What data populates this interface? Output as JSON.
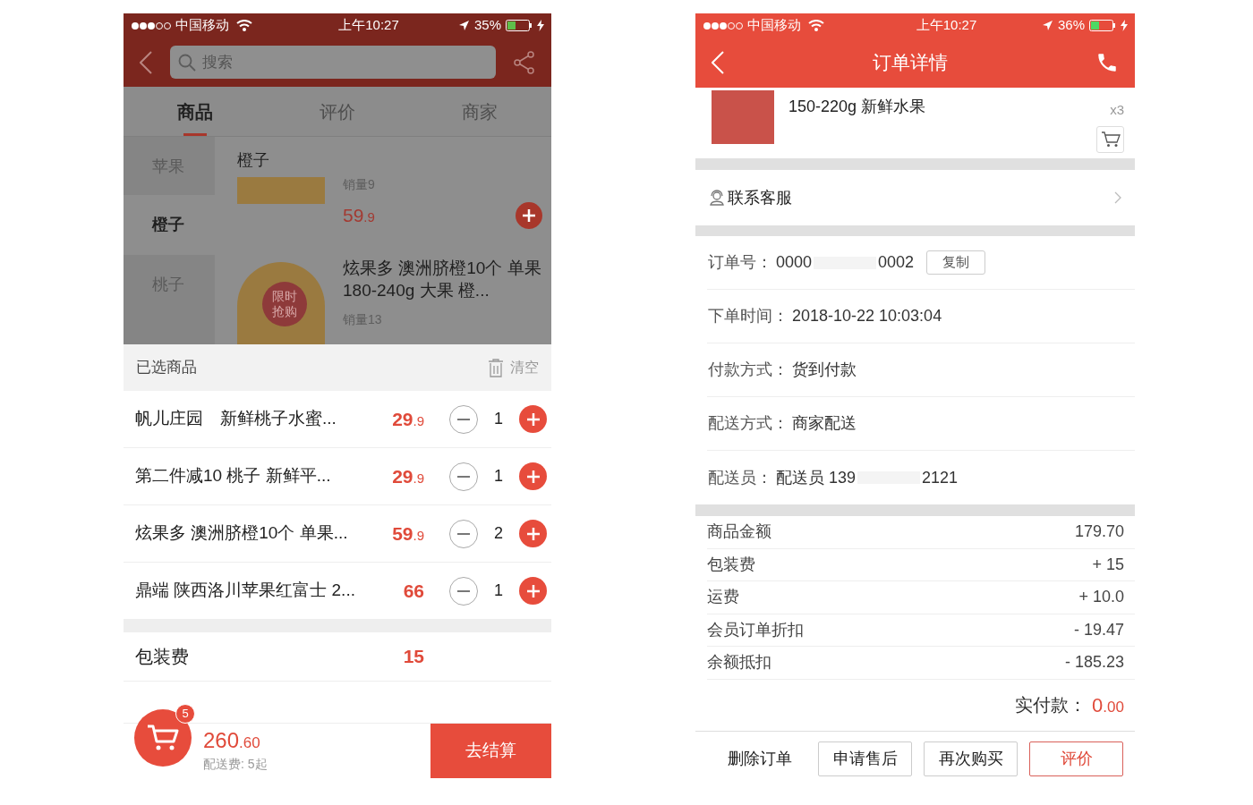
{
  "left_screen": {
    "status_bar": {
      "carrier": "中国移动",
      "time": "上午10:27",
      "battery": "35%"
    },
    "search": {
      "placeholder": "搜索"
    },
    "tabs": [
      {
        "label": "商品",
        "selected": true
      },
      {
        "label": "评价",
        "selected": false
      },
      {
        "label": "商家",
        "selected": false
      }
    ],
    "categories": [
      {
        "label": "苹果",
        "selected": false
      },
      {
        "label": "橙子",
        "selected": true
      },
      {
        "label": "桃子",
        "selected": false
      }
    ],
    "section_title": "橙子",
    "products": [
      {
        "sales": "销量9",
        "price_main": "59",
        "price_decimal": ".9"
      },
      {
        "badge": "限时抢购",
        "name": "炫果多 澳洲脐橙10个 单果180-240g 大果 橙...",
        "sales": "销量13"
      }
    ],
    "cart": {
      "title": "已选商品",
      "clear": "清空",
      "items": [
        {
          "name": "帆儿庄园　新鲜桃子水蜜...",
          "price_main": "29",
          "price_decimal": ".9",
          "qty": "1"
        },
        {
          "name": "第二件减10  桃子 新鲜平...",
          "price_main": "29",
          "price_decimal": ".9",
          "qty": "1"
        },
        {
          "name": "炫果多 澳洲脐橙10个 单果...",
          "price_main": "59",
          "price_decimal": ".9",
          "qty": "2"
        },
        {
          "name": "鼎端 陕西洛川苹果红富士 2...",
          "price_main": "66",
          "qty": "1"
        }
      ],
      "packaging": {
        "label": "包装费",
        "amount": "15"
      },
      "count": "5",
      "total_main": "260",
      "total_decimal": ".60",
      "delivery_note": "配送费: 5起",
      "checkout": "去结算"
    }
  },
  "right_screen": {
    "status_bar": {
      "carrier": "中国移动",
      "time": "上午10:27",
      "battery": "36%"
    },
    "title": "订单详情",
    "order_item": {
      "name": "150-220g 新鲜水果",
      "quantity": "x3"
    },
    "contact": "联系客服",
    "info_rows": [
      {
        "label": "订单号：",
        "value": "0000",
        "value_tail": "0002",
        "action": "复制"
      },
      {
        "label": "下单时间：",
        "value": "2018-10-22 10:03:04"
      },
      {
        "label": "付款方式：",
        "value": "货到付款"
      },
      {
        "label": "配送方式：",
        "value": "商家配送"
      },
      {
        "label": "配送员：",
        "value": "配送员 139",
        "value_tail": "2121"
      }
    ],
    "fees": [
      {
        "label": "商品金额",
        "amount": "179.70"
      },
      {
        "label": "包装费",
        "amount": "+ 15"
      },
      {
        "label": "运费",
        "amount": "+ 10.0"
      },
      {
        "label": "会员订单折扣",
        "amount": "- 19.47"
      },
      {
        "label": "余额抵扣",
        "amount": "- 185.23"
      }
    ],
    "paid": {
      "label": "实付款：",
      "main": "0",
      "decimal": ".00"
    },
    "actions": [
      {
        "label": "删除订单",
        "kind": "plain"
      },
      {
        "label": "申请售后",
        "kind": "outline"
      },
      {
        "label": "再次购买",
        "kind": "outline"
      },
      {
        "label": "评价",
        "kind": "primary"
      }
    ]
  }
}
